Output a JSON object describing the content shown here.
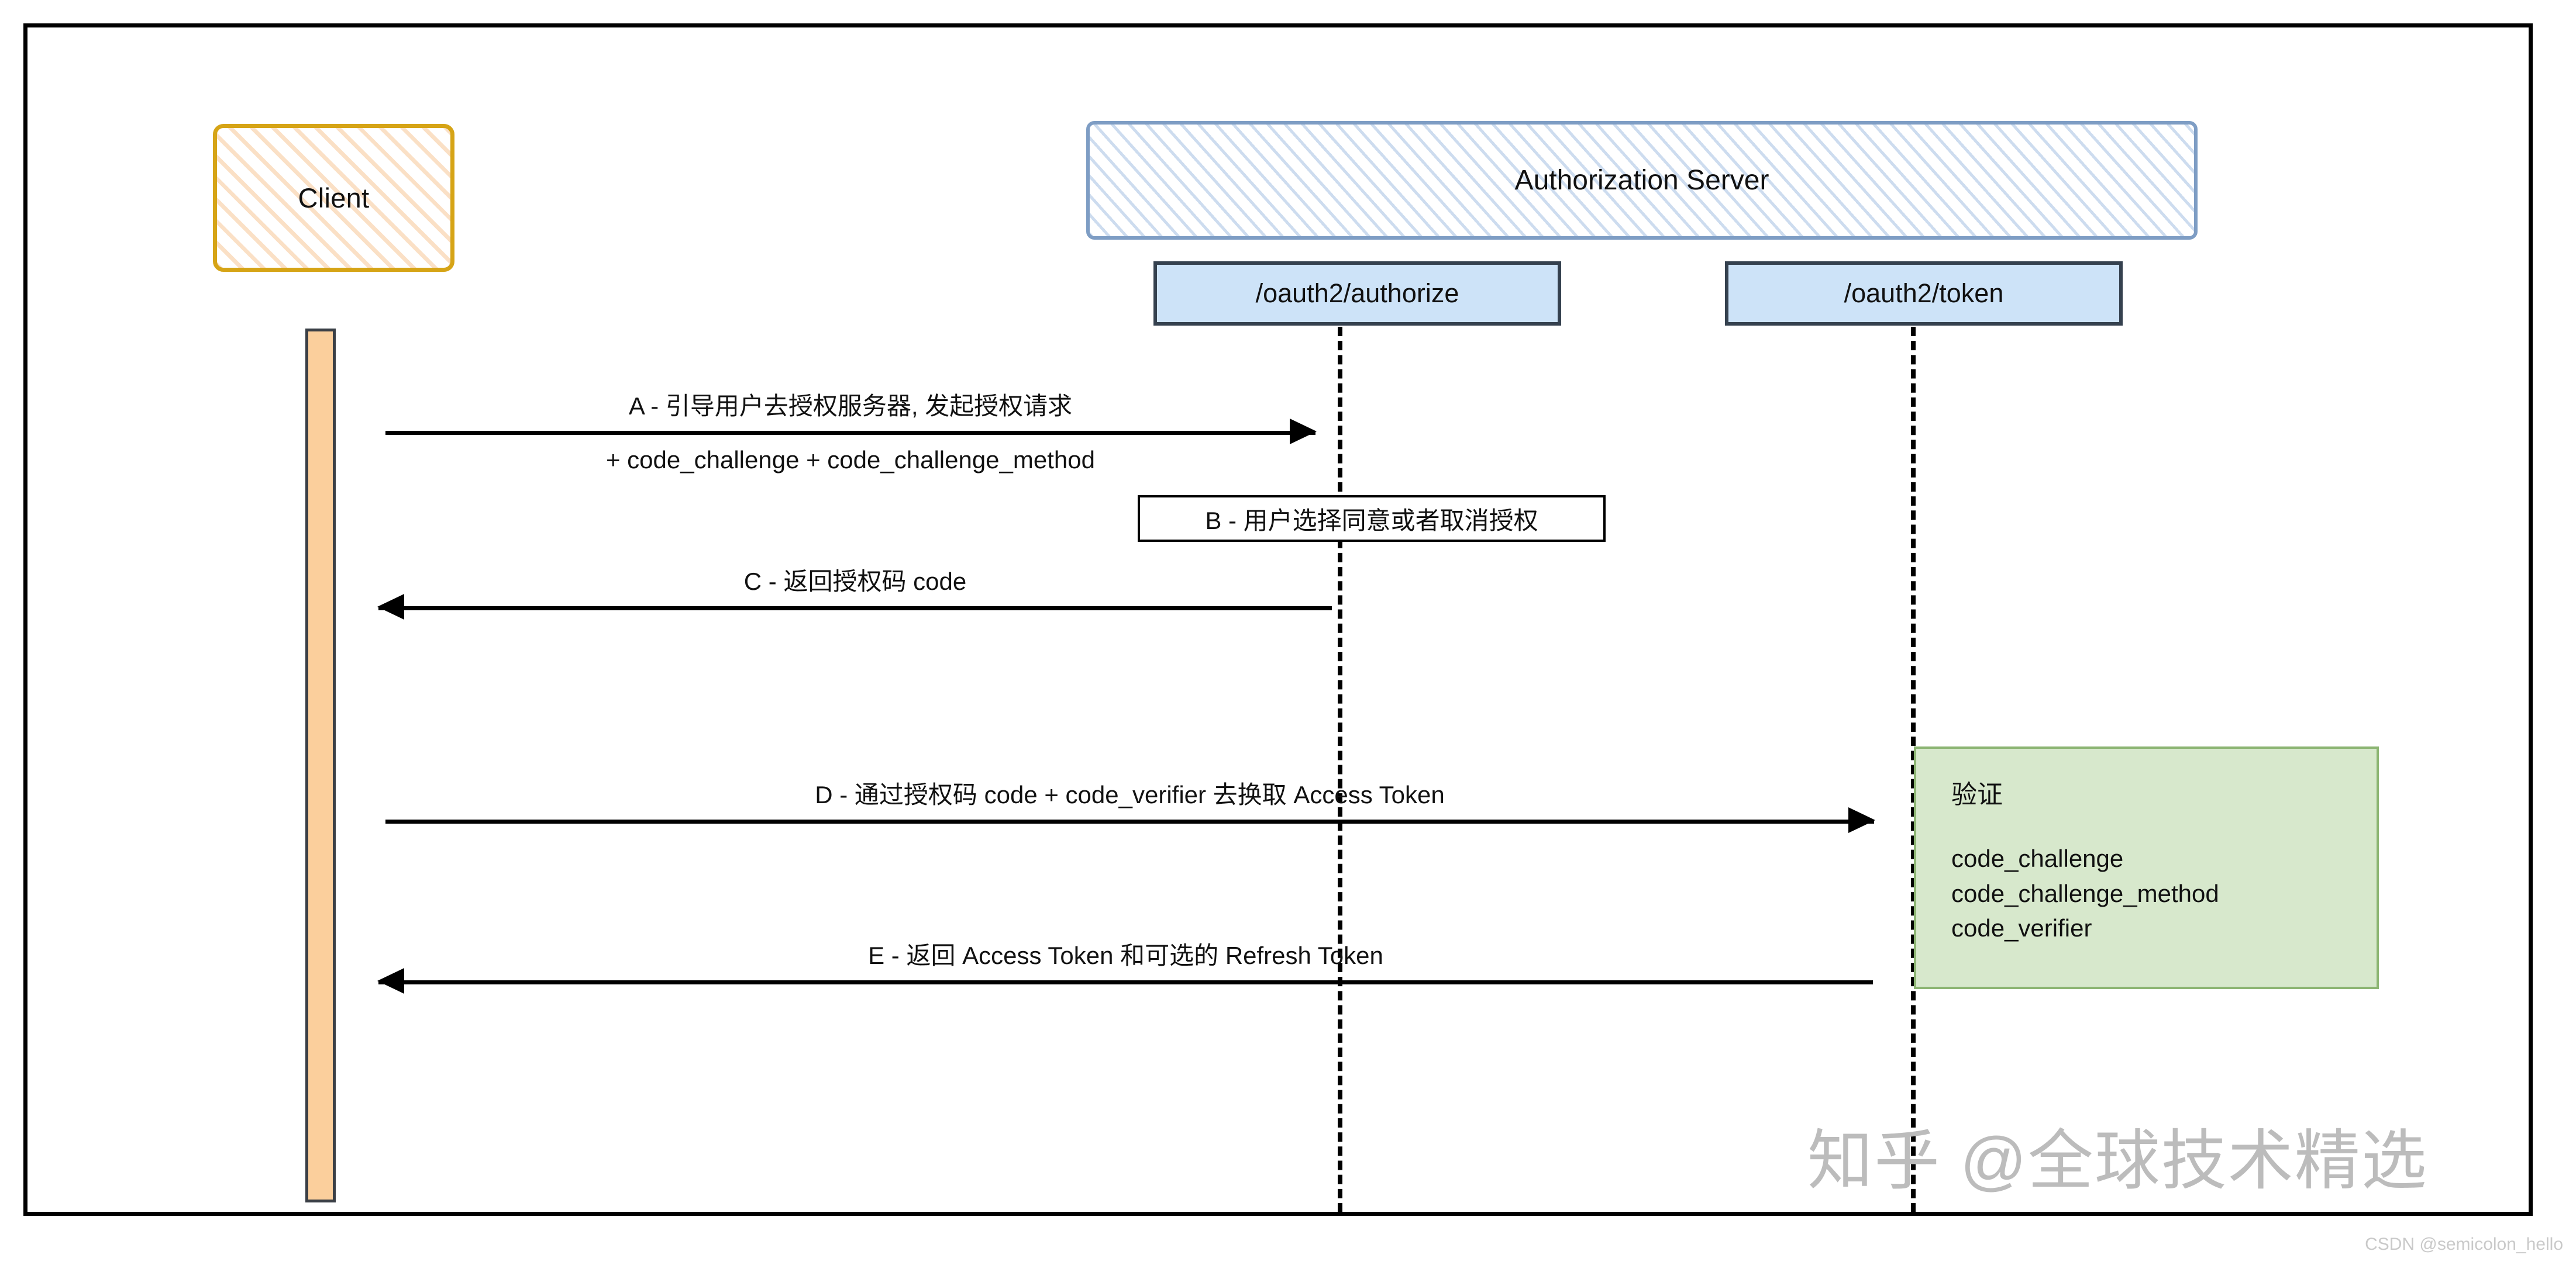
{
  "diagram": {
    "title": "OAuth2 PKCE Authorization Code Flow Sequence Diagram",
    "participants": {
      "client": {
        "label": "Client"
      },
      "auth_server": {
        "label": "Authorization Server"
      },
      "endpoint_authorize": {
        "label": "/oauth2/authorize"
      },
      "endpoint_token": {
        "label": "/oauth2/token"
      }
    },
    "messages": [
      {
        "id": "A",
        "label": "A - 引导用户去授权服务器, 发起授权请求",
        "sub_label": "+ code_challenge + code_challenge_method",
        "direction": "right",
        "from": "client",
        "to": "endpoint_authorize"
      },
      {
        "id": "C",
        "label": "C - 返回授权码 code",
        "direction": "left",
        "from": "endpoint_authorize",
        "to": "client"
      },
      {
        "id": "D",
        "label": "D - 通过授权码 code + code_verifier 去换取 Access Token",
        "direction": "right",
        "from": "client",
        "to": "endpoint_token"
      },
      {
        "id": "E",
        "label": "E - 返回 Access Token 和可选的 Refresh Token",
        "direction": "left",
        "from": "endpoint_token",
        "to": "client"
      }
    ],
    "note_b": {
      "label": "B - 用户选择同意或者取消授权"
    },
    "verification": {
      "title": "验证",
      "items": [
        "code_challenge",
        "code_challenge_method",
        "code_verifier"
      ]
    },
    "watermarks": {
      "zhihu": "知乎 @全球技术精选",
      "csdn": "CSDN @semicolon_hello"
    },
    "colors": {
      "client_border": "#d6a416",
      "client_hatch": "#f7c696",
      "auth_server_border": "#7e9dc4",
      "auth_server_hatch": "#96b6de",
      "endpoint_fill": "#cde3f8",
      "endpoint_border": "#35414f",
      "activation_fill": "#fbcf9c",
      "activation_border": "#3a3f46",
      "verify_fill": "#d7e8cc",
      "verify_border": "#8cb573",
      "line": "#000000",
      "watermark": "#bcbcbc"
    }
  }
}
